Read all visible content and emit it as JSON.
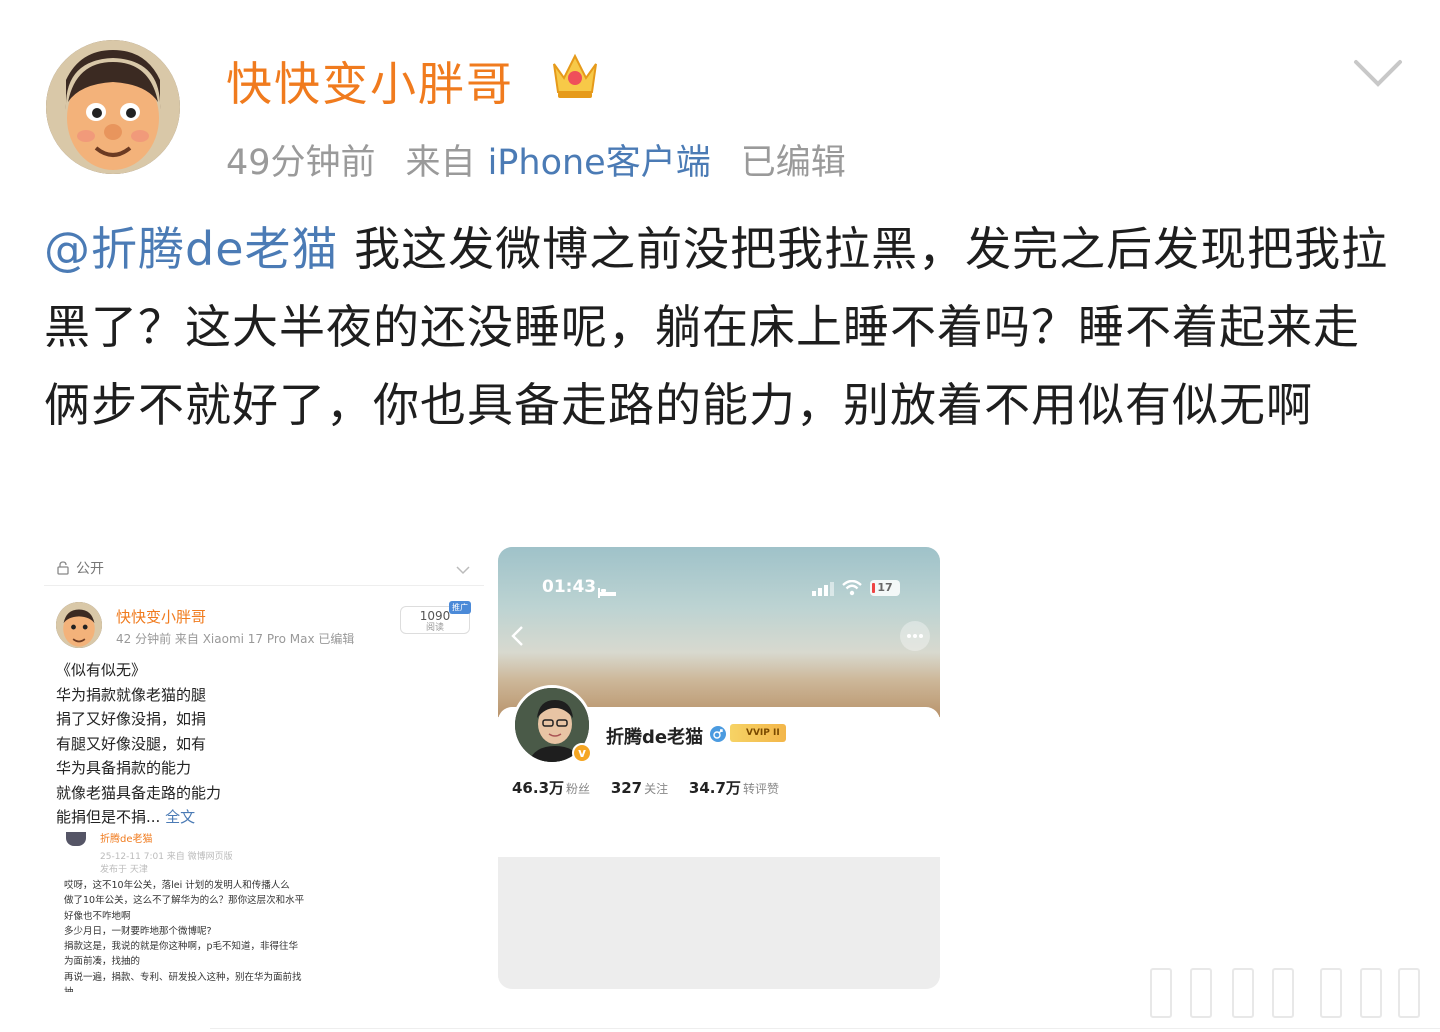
{
  "post": {
    "username": "快快变小胖哥",
    "time_ago": "49分钟前",
    "source_prefix": "来自",
    "source": "iPhone客户端",
    "edited": "已编辑",
    "mention": "@折腾de老猫",
    "text": " 我这发微博之前没把我拉黑，发完之后发现把我拉黑了？这大半夜的还没睡呢，躺在床上睡不着吗？睡不着起来走俩步不就好了，你也具备走路的能力，别放着不用似有似无啊",
    "icons": [
      "crown-icon",
      "chevron-down-icon"
    ]
  },
  "screenshot1": {
    "visibility": "公开",
    "username": "快快变小胖哥",
    "meta": "42 分钟前  来自 Xiaomi 17 Pro Max  已编辑",
    "reads_count": "1090",
    "reads_label": "阅读",
    "reads_tag": "推广",
    "poem_lines": [
      "《似有似无》",
      "华为捐款就像老猫的腿",
      "捐了又好像没捐，如捐",
      "有腿又好像没腿，如有",
      "华为具备捐款的能力",
      "就像老猫具备走路的能力",
      "能捐但是不捐..."
    ],
    "more_label": "全文",
    "embed_name": "折腾de老猫",
    "embed_meta": "25-12-11 7:01  来自 微博网页版",
    "embed_loc": "发布于 天津",
    "embed_lines": [
      "哎呀，这不10年公关，落lei 计划的发明人和传播人么",
      "做了10年公关，这么不了解华为的么？那你这层次和水平",
      "好像也不咋地啊",
      "多少月日，一财要昨地那个微博呢?",
      "捐款这是，我说的就是你这种啊，p毛不知道，非得往华",
      "为面前凑，找抽的",
      "再说一遍，捐款、专利、研发投入这种，别在华为面前找",
      "抽"
    ]
  },
  "screenshot2": {
    "time": "01:43",
    "battery": "17",
    "name": "折腾de老猫",
    "vip_label": "VVIP II",
    "followers_value": "46.3万",
    "followers_label": "粉丝",
    "following_value": "327",
    "following_label": "关注",
    "likes_value": "34.7万",
    "likes_label": "转评赞"
  }
}
